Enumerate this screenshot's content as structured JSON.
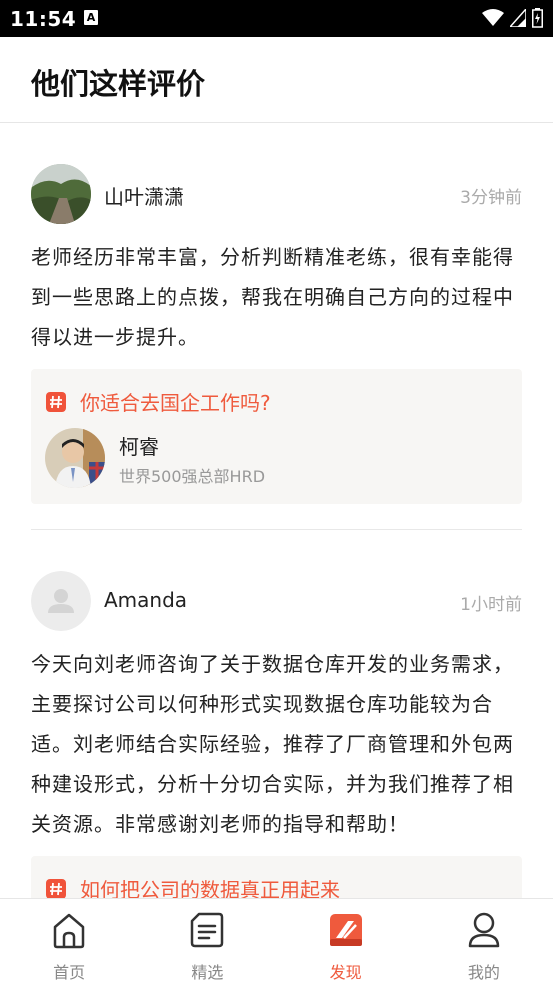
{
  "status_bar": {
    "time": "11:54",
    "notification_badge": "A"
  },
  "header": {
    "title": "他们这样评价"
  },
  "reviews": [
    {
      "author": "山叶潇潇",
      "time": "3分钟前",
      "text": "老师经历非常丰富，分析判断精准老练，很有幸能得到一些思路上的点拨，帮我在明确自己方向的过程中得以进一步提升。",
      "topic": {
        "title": "你适合去国企工作吗?",
        "mentor_name": "柯睿",
        "mentor_title": "世界500强总部HRD"
      }
    },
    {
      "author": "Amanda",
      "time": "1小时前",
      "text": "今天向刘老师咨询了关于数据仓库开发的业务需求，主要探讨公司以何种形式实现数据仓库功能较为合适。刘老师结合实际经验，推荐了厂商管理和外包两种建设形式，分析十分切合实际，并为我们推荐了相关资源。非常感谢刘老师的指导和帮助！",
      "topic": {
        "title": "如何把公司的数据真正用起来"
      }
    }
  ],
  "tabs": [
    {
      "label": "首页",
      "icon": "home-icon"
    },
    {
      "label": "精选",
      "icon": "document-icon"
    },
    {
      "label": "发现",
      "icon": "discover-icon",
      "active": true
    },
    {
      "label": "我的",
      "icon": "person-icon"
    }
  ],
  "colors": {
    "accent": "#ef5a3d",
    "card_bg": "#f7f6f4",
    "muted": "#aaaaaa"
  }
}
